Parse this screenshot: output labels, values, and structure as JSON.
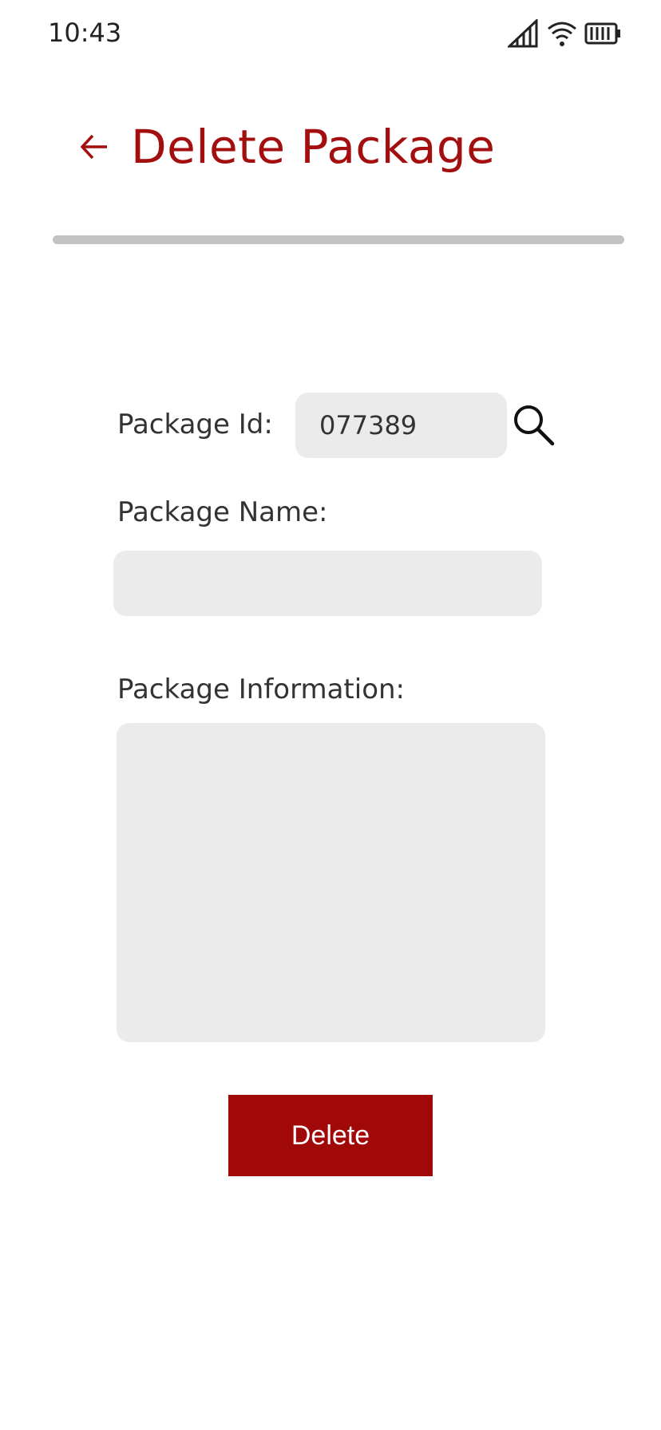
{
  "status_bar": {
    "time": "10:43",
    "icons": [
      "signal-icon",
      "wifi-icon",
      "battery-icon"
    ]
  },
  "header": {
    "back_icon": "arrow-left-icon",
    "title": "Delete Package"
  },
  "form": {
    "package_id_label": "Package Id:",
    "package_id_value": "077389",
    "search_icon": "search-icon",
    "package_name_label": "Package Name:",
    "package_name_value": "",
    "package_info_label": "Package Information:",
    "package_info_value": ""
  },
  "actions": {
    "delete_label": "Delete"
  },
  "colors": {
    "accent": "#a30f0f",
    "button": "#a10808",
    "field_bg": "#ebebeb",
    "divider": "#c2c2c2"
  }
}
